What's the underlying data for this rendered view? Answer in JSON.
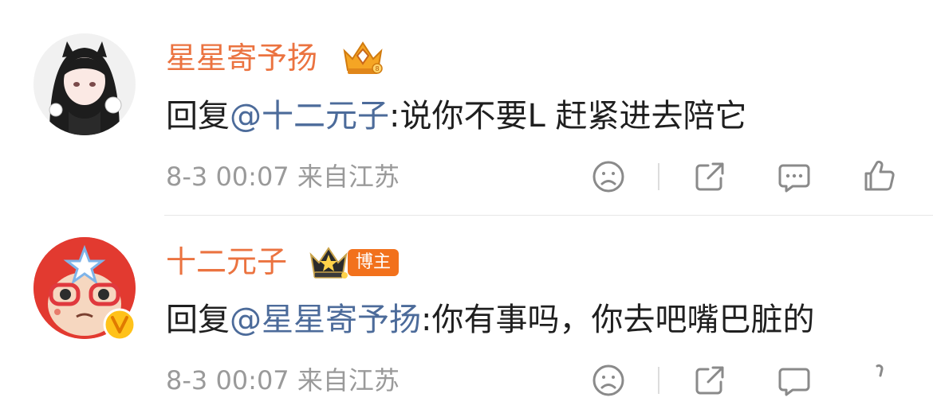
{
  "comments": [
    {
      "username": "星星寄予扬",
      "reply_prefix": "回复",
      "mention": "@十二元子",
      "text": ":说你不要L 赶紧进去陪它",
      "meta": "8-3 00:07 来自江苏"
    },
    {
      "username": "十二元子",
      "badge": "博主",
      "reply_prefix": "回复",
      "mention": "@星星寄予扬",
      "text": ":你有事吗，你去吧嘴巴脏的",
      "meta": "8-3 00:07 来自江苏"
    }
  ],
  "colors": {
    "username": "#eb7340",
    "mention": "#4c6b9a",
    "meta": "#9a9a9a",
    "icon": "#8a8a8a",
    "badge": "#f2711c"
  },
  "icons": [
    "crown-badge-icon",
    "sad-face-icon",
    "share-icon",
    "comment-icon",
    "like-icon",
    "verified-v-icon"
  ]
}
